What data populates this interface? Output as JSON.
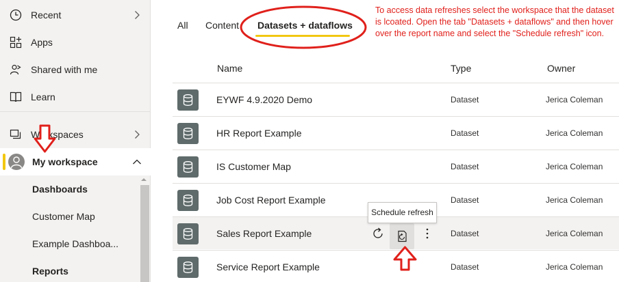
{
  "sidebar": {
    "items": [
      {
        "label": "Recent",
        "icon": "clock-icon",
        "has_chevron": true
      },
      {
        "label": "Apps",
        "icon": "apps-icon",
        "has_chevron": false
      },
      {
        "label": "Shared with me",
        "icon": "shared-icon",
        "has_chevron": false
      },
      {
        "label": "Learn",
        "icon": "book-icon",
        "has_chevron": false
      },
      {
        "label": "Workspaces",
        "icon": "workspaces-icon",
        "has_chevron": true
      }
    ],
    "my_workspace": {
      "label": "My workspace",
      "expanded": true
    },
    "sub_items": [
      {
        "label": "Dashboards",
        "bold": true
      },
      {
        "label": "Customer Map",
        "bold": false
      },
      {
        "label": "Example Dashboa...",
        "bold": false
      },
      {
        "label": "Reports",
        "bold": true
      }
    ]
  },
  "tabs": [
    {
      "label": "All",
      "active": false
    },
    {
      "label": "Content",
      "active": false
    },
    {
      "label": "Datasets + dataflows",
      "active": true
    }
  ],
  "columns": {
    "name": "Name",
    "type": "Type",
    "owner": "Owner"
  },
  "rows": [
    {
      "name": "EYWF 4.9.2020 Demo",
      "type": "Dataset",
      "owner": "Jerica Coleman"
    },
    {
      "name": "HR Report Example",
      "type": "Dataset",
      "owner": "Jerica Coleman"
    },
    {
      "name": "IS Customer Map",
      "type": "Dataset",
      "owner": "Jerica Coleman"
    },
    {
      "name": "Job Cost Report Example",
      "type": "Dataset",
      "owner": "Jerica Coleman"
    },
    {
      "name": "Sales Report Example",
      "type": "Dataset",
      "owner": "Jerica Coleman",
      "hovered": true
    },
    {
      "name": "Service Report Example",
      "type": "Dataset",
      "owner": "Jerica Coleman"
    }
  ],
  "tooltip": {
    "text": "Schedule refresh"
  },
  "annotation": {
    "text": "To access data refreshes select the workspace that the dataset is lcoated. Open the tab \"Datasets + dataflows\" and then hover over the report name and select the \"Schedule refresh\" icon.",
    "color": "#e0201b"
  },
  "colors": {
    "accent": "#f2c811",
    "dataset_icon": "#5f6a6a",
    "annotation_red": "#e0201b"
  }
}
